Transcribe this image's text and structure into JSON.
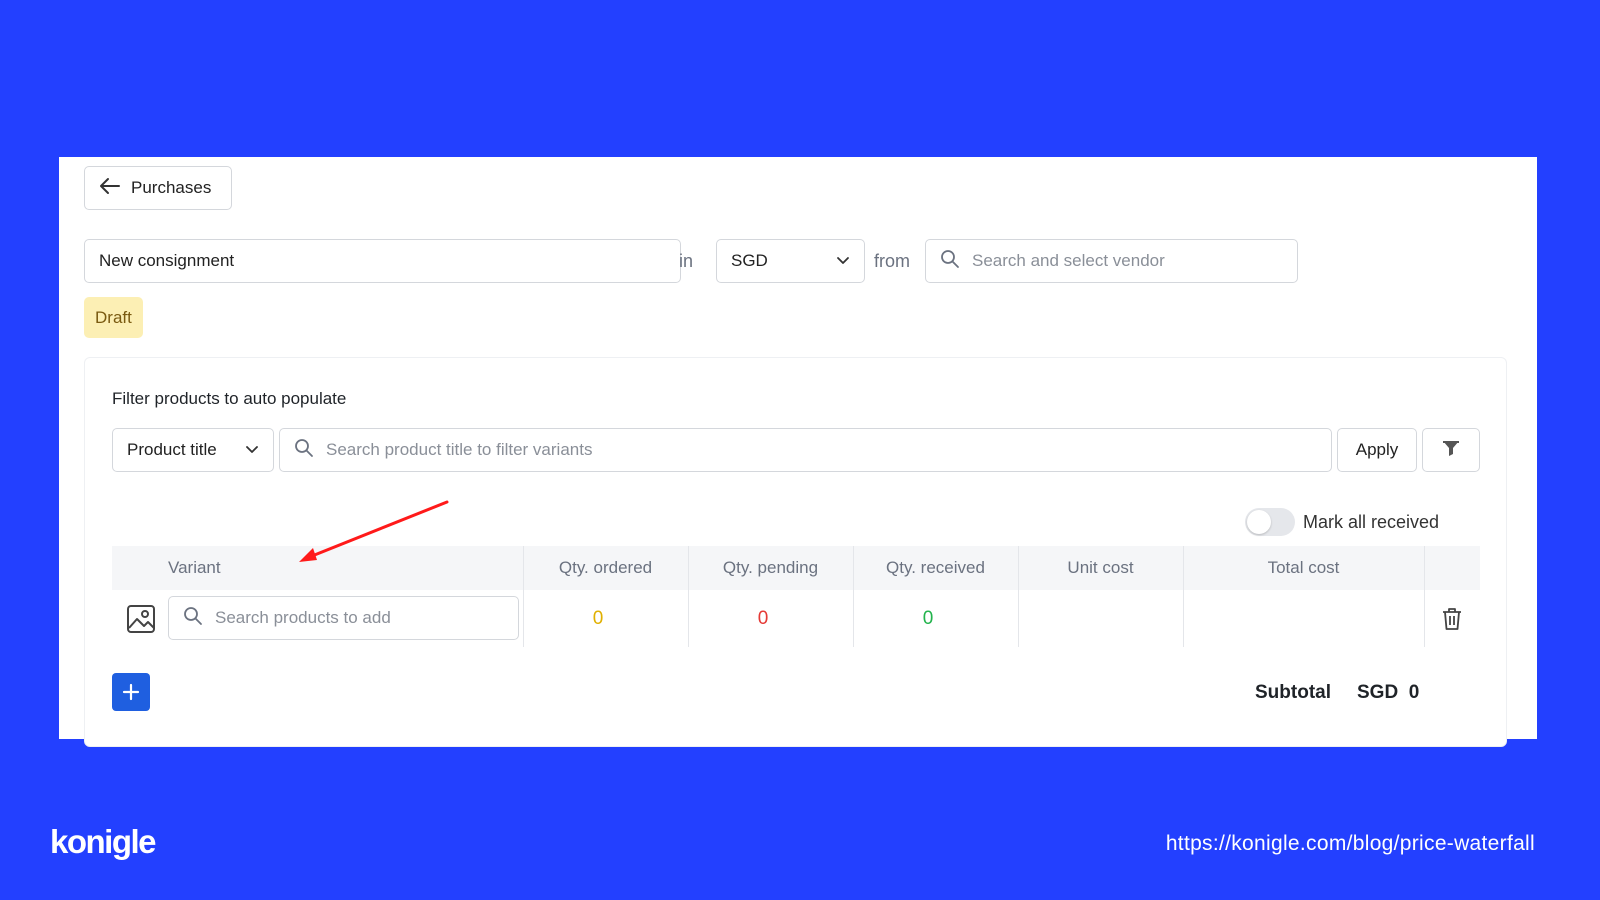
{
  "header": {
    "back_label": "Purchases"
  },
  "form": {
    "consignment_name": "New consignment",
    "in_label": "in",
    "currency": "SGD",
    "from_label": "from",
    "vendor_placeholder": "Search and select vendor",
    "status": "Draft"
  },
  "filter": {
    "title": "Filter products to auto populate",
    "type": "Product title",
    "search_placeholder": "Search product title to filter variants",
    "apply_label": "Apply"
  },
  "mark_all_received": {
    "label": "Mark all received",
    "on": false
  },
  "table": {
    "columns": {
      "variant": "Variant",
      "qty_ordered": "Qty. ordered",
      "qty_pending": "Qty. pending",
      "qty_received": "Qty. received",
      "unit_cost": "Unit cost",
      "total_cost": "Total cost"
    },
    "row": {
      "search_placeholder": "Search products to add",
      "qty_ordered": "0",
      "qty_pending": "0",
      "qty_received": "0"
    }
  },
  "footer": {
    "subtotal_label": "Subtotal",
    "subtotal_value": "SGD  0"
  },
  "branding": {
    "logo": "konigle",
    "url": "https://konigle.com/blog/price-waterfall"
  },
  "colors": {
    "background": "#2340ff",
    "accent": "#1f5fe0",
    "qty_ordered": "#e0b000",
    "qty_pending": "#e53935",
    "qty_received": "#22b34c",
    "draft_badge": "#fcefb4",
    "annotation_arrow": "#ff1a1a"
  },
  "icons": [
    "arrow-left-icon",
    "chevron-down-icon",
    "search-icon",
    "funnel-icon",
    "image-icon",
    "trash-icon",
    "plus-icon"
  ]
}
